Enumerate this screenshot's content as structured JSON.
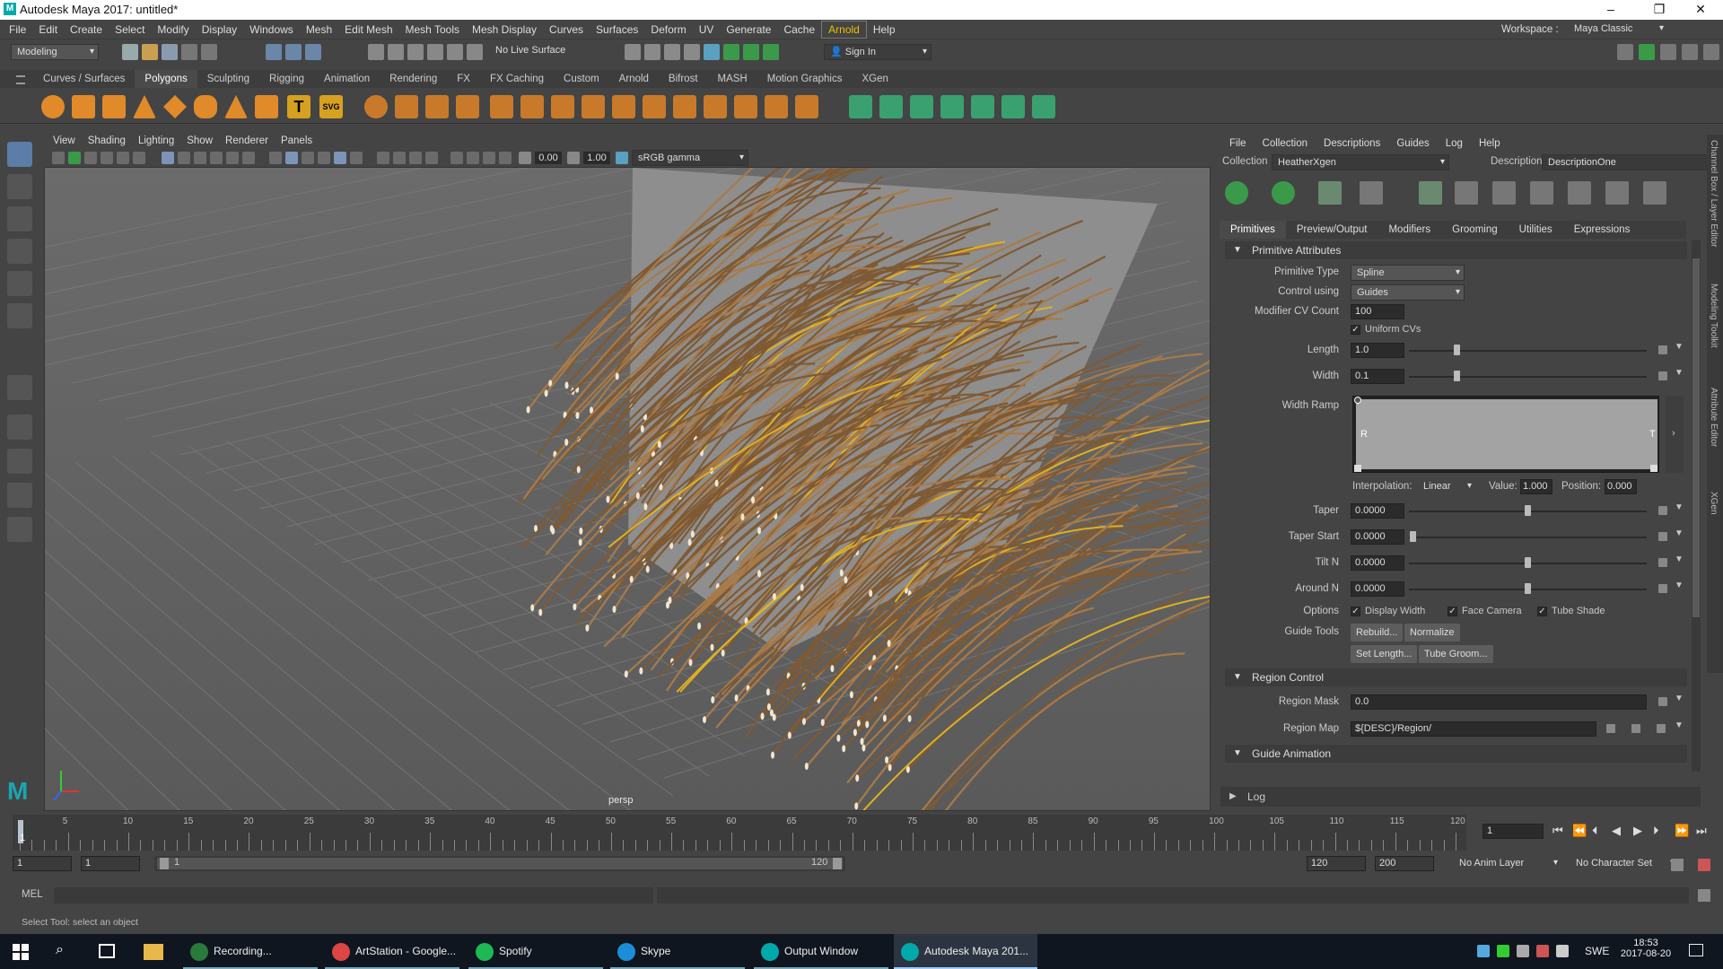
{
  "window": {
    "title": "Autodesk Maya 2017: untitled*"
  },
  "menubar": {
    "items": [
      "File",
      "Edit",
      "Create",
      "Select",
      "Modify",
      "Display",
      "Windows",
      "Mesh",
      "Edit Mesh",
      "Mesh Tools",
      "Mesh Display",
      "Curves",
      "Surfaces",
      "Deform",
      "UV",
      "Generate",
      "Cache",
      "Arnold",
      "Help"
    ],
    "workspace_label": "Workspace :",
    "workspace_value": "Maya Classic"
  },
  "statusline": {
    "mode": "Modeling",
    "live_surface": "No Live Surface",
    "sign_in": "Sign In"
  },
  "shelf": {
    "tabs": [
      "Curves / Surfaces",
      "Polygons",
      "Sculpting",
      "Rigging",
      "Animation",
      "Rendering",
      "FX",
      "FX Caching",
      "Custom",
      "Arnold",
      "Bifrost",
      "MASH",
      "Motion Graphics",
      "XGen"
    ],
    "active": "Polygons"
  },
  "viewport": {
    "menus": [
      "View",
      "Shading",
      "Lighting",
      "Show",
      "Renderer",
      "Panels"
    ],
    "exposure": "0.00",
    "gamma": "1.00",
    "color_space": "sRGB gamma",
    "camera_label": "persp"
  },
  "xgen": {
    "menus": [
      "File",
      "Collection",
      "Descriptions",
      "Guides",
      "Log",
      "Help"
    ],
    "collection_label": "Collection",
    "collection_value": "HeatherXgen",
    "description_label": "Description",
    "description_value": "DescriptionOne",
    "tabs": [
      "Primitives",
      "Preview/Output",
      "Modifiers",
      "Grooming",
      "Utilities",
      "Expressions"
    ],
    "active_tab": "Primitives",
    "primitive_section": "Primitive Attributes",
    "primitive_type_label": "Primitive Type",
    "primitive_type": "Spline",
    "control_using_label": "Control using",
    "control_using": "Guides",
    "modifier_cv_label": "Modifier CV Count",
    "modifier_cv": "100",
    "uniform_cvs": "Uniform CVs",
    "length_label": "Length",
    "length": "1.0",
    "length_level": 0.2,
    "width_label": "Width",
    "width": "0.1",
    "width_level": 0.2,
    "width_ramp_label": "Width Ramp",
    "ramp_r": "R",
    "ramp_t": "T",
    "interp_label": "Interpolation:",
    "interp_value": "Linear",
    "value_label": "Value:",
    "value": "1.000",
    "position_label": "Position:",
    "position": "0.000",
    "taper_label": "Taper",
    "taper": "0.0000",
    "taper_start_label": "Taper Start",
    "taper_start": "0.0000",
    "tilt_label": "Tilt N",
    "tilt": "0.0000",
    "around_label": "Around N",
    "around": "0.0000",
    "options_label": "Options",
    "display_width": "Display Width",
    "face_camera": "Face Camera",
    "tube_shade": "Tube Shade",
    "guide_tools_label": "Guide Tools",
    "rebuild": "Rebuild...",
    "normalize": "Normalize",
    "set_length": "Set Length...",
    "tube_groom": "Tube Groom...",
    "region_section": "Region Control",
    "region_mask_label": "Region Mask",
    "region_mask": "0.0",
    "region_map_label": "Region Map",
    "region_map": "${DESC}/Region/",
    "guide_anim_section": "Guide Animation",
    "log_section": "Log"
  },
  "side_tabs": [
    "Channel Box / Layer Editor",
    "Modeling Toolkit",
    "Attribute Editor",
    "XGen"
  ],
  "timeline": {
    "ticks": [
      "5",
      "10",
      "15",
      "20",
      "25",
      "30",
      "35",
      "40",
      "45",
      "50",
      "55",
      "60",
      "65",
      "70",
      "75",
      "80",
      "85",
      "90",
      "95",
      "100",
      "105",
      "110",
      "115",
      "120"
    ],
    "current_frame": "1",
    "current_marker": "1"
  },
  "range": {
    "start": "1",
    "start2": "1",
    "slider_start": "1",
    "slider_end": "120",
    "end": "120",
    "end2": "200",
    "anim_layer": "No Anim Layer",
    "character_set": "No Character Set"
  },
  "cmdline": {
    "lang": "MEL"
  },
  "helpline": {
    "text": "Select Tool: select an object"
  },
  "taskbar": {
    "apps": [
      {
        "label": "Recording...",
        "color": "#2a7a3a"
      },
      {
        "label": "ArtStation - Google...",
        "color": "#d44"
      },
      {
        "label": "Spotify",
        "color": "#1db954"
      },
      {
        "label": "Skype",
        "color": "#1a8fd8"
      },
      {
        "label": "Output Window",
        "color": "#0aa"
      },
      {
        "label": "Autodesk Maya 201...",
        "color": "#0aa"
      }
    ],
    "lang": "SWE",
    "time": "18:53",
    "date": "2017-08-20"
  }
}
